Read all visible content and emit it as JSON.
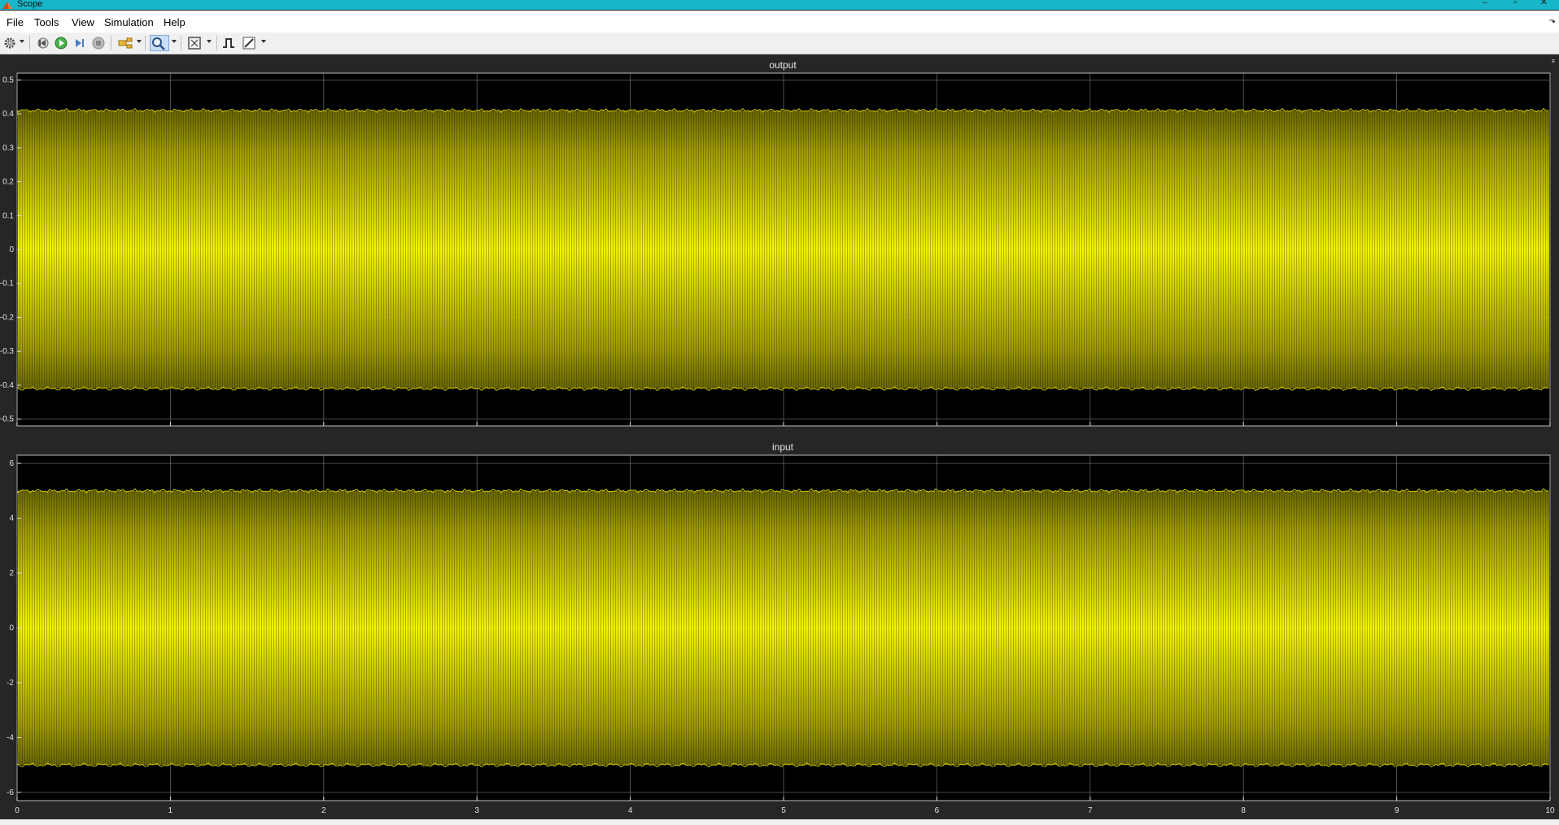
{
  "window": {
    "title": "Scope"
  },
  "menu": [
    "File",
    "Tools",
    "View",
    "Simulation",
    "Help"
  ],
  "toolbar": {
    "buttons": [
      {
        "name": "settings-gear-button",
        "icon": "gear-icon"
      },
      {
        "name": "step-back-button",
        "icon": "step-back-icon"
      },
      {
        "name": "run-button",
        "icon": "play-icon"
      },
      {
        "name": "step-forward-button",
        "icon": "step-forward-icon"
      },
      {
        "name": "stop-button",
        "icon": "stop-icon"
      },
      {
        "name": "highlight-block-button",
        "icon": "highlight-icon"
      },
      {
        "name": "zoom-button",
        "icon": "zoom-in-icon"
      },
      {
        "name": "autoscale-button",
        "icon": "autoscale-icon"
      },
      {
        "name": "signal-trigger-button",
        "icon": "trigger-icon"
      },
      {
        "name": "measurements-button",
        "icon": "measure-icon"
      }
    ]
  },
  "colors": {
    "trace": "#ffff00",
    "plot_bg": "#000000",
    "figure_bg": "#262626",
    "grid": "#8a8a8a",
    "titlebar": "#17b6c8"
  },
  "chart_data": [
    {
      "type": "line",
      "title": "output",
      "x": [
        0,
        10
      ],
      "y_envelope_upper": 0.41,
      "y_envelope_lower": -0.41,
      "xlim": [
        0,
        10
      ],
      "ylim": [
        -0.52,
        0.52
      ],
      "x_ticks": [
        0,
        1,
        2,
        3,
        4,
        5,
        6,
        7,
        8,
        9,
        10
      ],
      "y_ticks": [
        0.5,
        0.4,
        0.3,
        0.2,
        0.1,
        0,
        -0.1,
        -0.2,
        -0.3,
        -0.4,
        -0.5
      ],
      "y_tick_labels": [
        "0.5",
        "0.4",
        "0.3",
        "0.2",
        "0.1",
        "0",
        "-0.1",
        "-0.2",
        "-0.3",
        "-0.4",
        "-0.5"
      ],
      "grid": true,
      "series_color": "#ffff00"
    },
    {
      "type": "line",
      "title": "input",
      "x": [
        0,
        10
      ],
      "y_envelope_upper": 5.0,
      "y_envelope_lower": -5.0,
      "xlim": [
        0,
        10
      ],
      "ylim": [
        -6.3,
        6.3
      ],
      "x_ticks": [
        0,
        1,
        2,
        3,
        4,
        5,
        6,
        7,
        8,
        9,
        10
      ],
      "x_tick_labels": [
        "0",
        "1",
        "2",
        "3",
        "4",
        "5",
        "6",
        "7",
        "8",
        "9",
        "10"
      ],
      "y_ticks": [
        6,
        4,
        2,
        0,
        -2,
        -4,
        -6
      ],
      "y_tick_labels": [
        "6",
        "4",
        "2",
        "0",
        "-2",
        "-4",
        "-6"
      ],
      "grid": true,
      "series_color": "#ffff00"
    }
  ]
}
